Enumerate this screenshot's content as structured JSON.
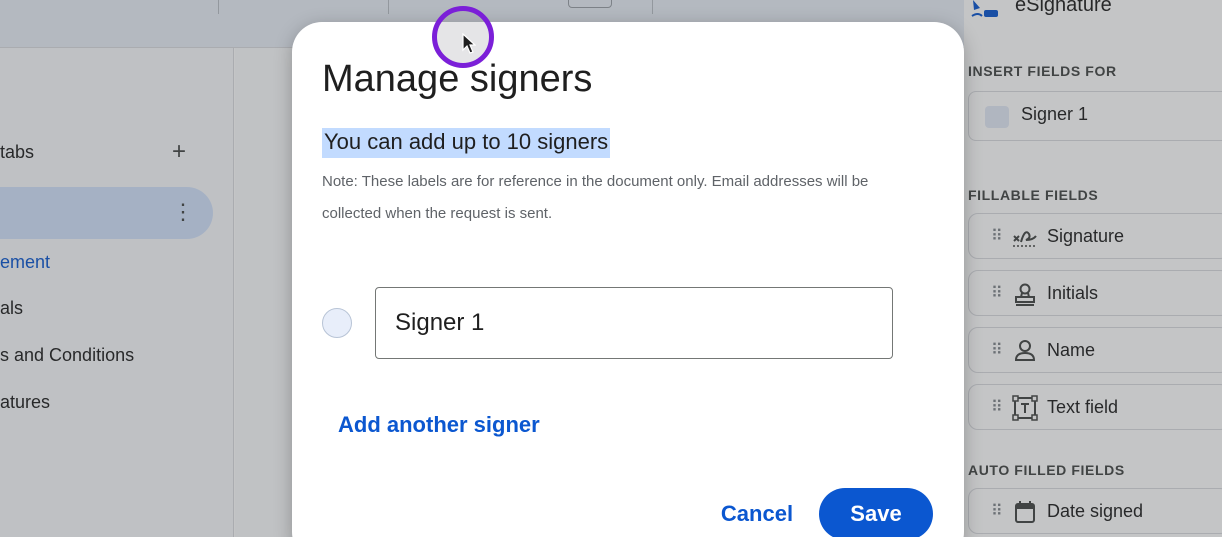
{
  "sidebar": {
    "tabs_label": "tabs",
    "add_tab_icon": "+",
    "tab_menu_icon": "⋮",
    "outline_items": [
      {
        "label": "ement"
      },
      {
        "label": "als"
      },
      {
        "label": "s and Conditions"
      },
      {
        "label": "atures"
      }
    ]
  },
  "right_panel": {
    "title": "eSignature",
    "insert_fields_for_heading": "INSERT FIELDS FOR",
    "selected_signer": "Signer 1",
    "fillable_fields_heading": "FILLABLE FIELDS",
    "fillable_fields": [
      {
        "label": "Signature",
        "icon": "signature-icon"
      },
      {
        "label": "Initials",
        "icon": "stamp-icon"
      },
      {
        "label": "Name",
        "icon": "person-icon"
      },
      {
        "label": "Text field",
        "icon": "text-field-icon"
      }
    ],
    "auto_filled_heading": "AUTO FILLED FIELDS",
    "auto_filled_fields": [
      {
        "label": "Date signed",
        "icon": "calendar-icon"
      }
    ]
  },
  "dialog": {
    "title": "Manage signers",
    "subtitle": "You can add up to 10 signers",
    "note": "Note: These labels are for reference in the document only. Email addresses will be collected when the request is sent.",
    "signers": [
      {
        "label": "Signer 1"
      }
    ],
    "add_signer_label": "Add another signer",
    "cancel_label": "Cancel",
    "save_label": "Save"
  },
  "colors": {
    "accent": "#0b57d0",
    "selection_highlight": "#c2dbff",
    "cursor_ring": "#7b1fd8"
  }
}
